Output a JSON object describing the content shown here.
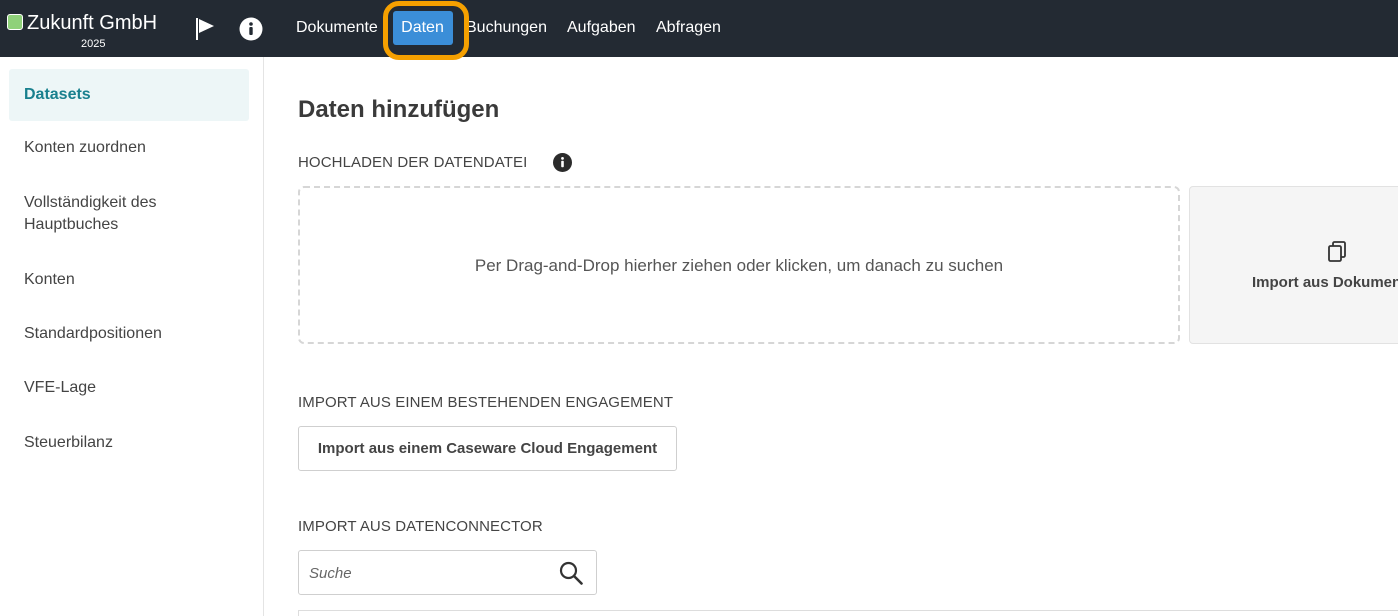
{
  "header": {
    "brand": {
      "title": "Zukunft GmbH",
      "year": "2025"
    },
    "icons": {
      "flag": "flag-icon",
      "info": "info-icon"
    },
    "nav": [
      {
        "id": "dokumente",
        "label": "Dokumente",
        "active": false
      },
      {
        "id": "daten",
        "label": "Daten",
        "active": true
      },
      {
        "id": "buchungen",
        "label": "Buchungen",
        "active": false
      },
      {
        "id": "aufgaben",
        "label": "Aufgaben",
        "active": false
      },
      {
        "id": "abfragen",
        "label": "Abfragen",
        "active": false
      }
    ],
    "colors": {
      "bar": "#232a33",
      "active_tab": "#3b8ed8",
      "highlight_ring": "#f5a000",
      "brand_square": "#8fd17a"
    }
  },
  "sidebar": {
    "active": "Datasets",
    "items": [
      {
        "label": "Datasets"
      },
      {
        "label": "Konten zuordnen"
      },
      {
        "label": "Vollständigkeit des Hauptbuches"
      },
      {
        "label": "Konten"
      },
      {
        "label": "Standardpositionen"
      },
      {
        "label": "VFE-Lage"
      },
      {
        "label": "Steuerbilanz"
      }
    ],
    "colors": {
      "active_bg": "#edf6f7",
      "active_text": "#19808e"
    }
  },
  "main": {
    "title": "Daten hinzufügen",
    "upload": {
      "label": "HOCHLADEN DER DATENDATEI",
      "info_icon": "info-icon",
      "dropzone_text": "Per Drag-and-Drop hierher ziehen oder klicken, um danach zu suchen",
      "doc_import_label": "Import aus Dokumenten",
      "doc_import_icon": "copy-documents-icon"
    },
    "engagement": {
      "label": "IMPORT AUS EINEM BESTEHENDEN ENGAGEMENT",
      "button_label": "Import aus einem Caseware Cloud Engagement"
    },
    "connector": {
      "label": "IMPORT AUS DATENCONNECTOR",
      "search_placeholder": "Suche",
      "search_icon": "search-icon"
    }
  }
}
